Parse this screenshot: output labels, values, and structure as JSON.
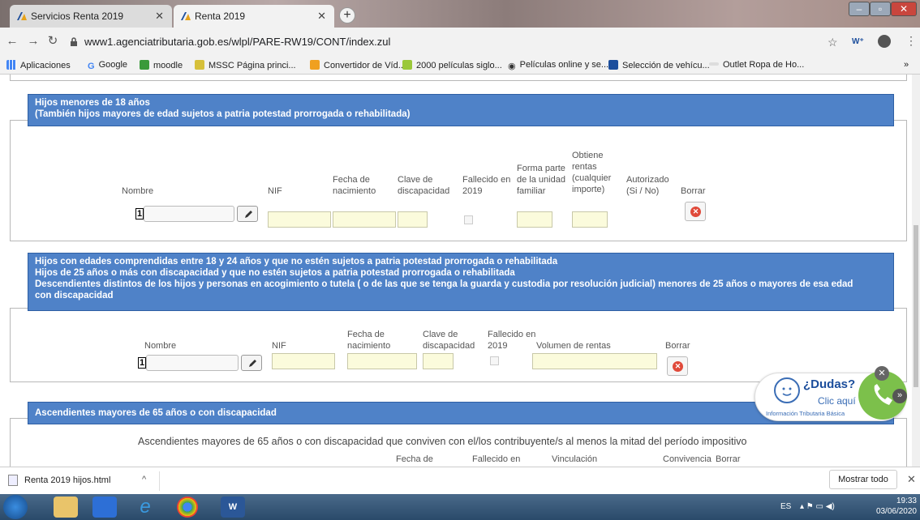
{
  "browser": {
    "tabs": [
      {
        "label": "Servicios Renta 2019",
        "active": false
      },
      {
        "label": "Renta 2019",
        "active": true
      }
    ],
    "new_tab": "+",
    "url": "www1.agenciatributaria.gob.es/wlpl/PARE-RW19/CONT/index.zul",
    "bookmarks": [
      "Aplicaciones",
      "Google",
      "moodle",
      "MSSC Página princi...",
      "Convertidor de Víd...",
      "2000 películas siglo...",
      "Películas online y se...",
      "Selección de vehícu...",
      "Outlet Ropa de Ho..."
    ],
    "more_bookmarks": "»"
  },
  "section1": {
    "header_line1": "Hijos menores de 18 años",
    "header_line2": "(También hijos mayores de edad sujetos a patria potestad prorrogada o rehabilitada)",
    "col_nombre": "Nombre",
    "col_nif": "NIF",
    "col_fecha_1": "Fecha de",
    "col_fecha_2": "nacimiento",
    "col_clave_1": "Clave de",
    "col_clave_2": "discapacidad",
    "col_fallecido_1": "Fallecido en",
    "col_fallecido_2": "2019",
    "col_forma_1": "Forma parte",
    "col_forma_2": "de la unidad",
    "col_forma_3": "familiar",
    "col_obtiene_1": "Obtiene",
    "col_obtiene_2": "rentas",
    "col_obtiene_3": "(cualquier",
    "col_obtiene_4": "importe)",
    "col_autorizado_1": "Autorizado",
    "col_autorizado_2": "(Si / No)",
    "col_borrar": "Borrar",
    "row_index": "1"
  },
  "section2": {
    "header_line1": "Hijos con edades comprendidas entre 18 y 24 años y que no estén sujetos a patria potestad prorrogada o rehabilitada",
    "header_line2": "Hijos de 25 años o más con discapacidad y que no estén sujetos a patria potestad prorrogada o rehabilitada",
    "header_line3": "Descendientes distintos de los hijos y personas en acogimiento o tutela ( o de las que se tenga la guarda y custodia por resolución judicial) menores de 25 años o mayores de esa edad",
    "header_line4": "con discapacidad",
    "col_nombre": "Nombre",
    "col_nif": "NIF",
    "col_fecha_1": "Fecha de",
    "col_fecha_2": "nacimiento",
    "col_clave_1": "Clave de",
    "col_clave_2": "discapacidad",
    "col_fallecido_1": "Fallecido en",
    "col_fallecido_2": "2019",
    "col_volumen": "Volumen de rentas",
    "col_borrar": "Borrar",
    "row_index": "1"
  },
  "section3": {
    "header": "Ascendientes mayores de 65 años o con discapacidad",
    "subtitle": "Ascendientes mayores de 65 años o con discapacidad que conviven con el/los contribuyente/s al menos la mitad del período impositivo",
    "col_fecha": "Fecha de",
    "col_fallecido": "Fallecido en",
    "col_vinculacion": "Vinculación",
    "col_convivencia": "Convivencia",
    "col_borrar": "Borrar"
  },
  "dudas": {
    "title": "¿Dudas?",
    "link": "Clic aquí",
    "caption": "Información Tributaria Básica"
  },
  "downloads": {
    "file": "Renta 2019 hijos.html",
    "show_all": "Mostrar todo"
  },
  "taskbar": {
    "lang": "ES",
    "time": "19:33",
    "date": "03/06/2020"
  },
  "colors": {
    "header_blue": "#4f82c8",
    "field_yellow": "#fbfbdc",
    "delete_red": "#e04a3a",
    "dudas_green": "#7cc04b"
  }
}
